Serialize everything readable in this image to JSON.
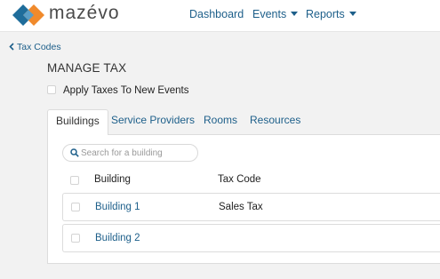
{
  "brand": {
    "name": "mazévo"
  },
  "nav": [
    {
      "label": "Dashboard",
      "has_caret": false
    },
    {
      "label": "Events",
      "has_caret": true
    },
    {
      "label": "Reports",
      "has_caret": true
    }
  ],
  "back_link": {
    "label": "Tax Codes"
  },
  "page_title": "MANAGE TAX",
  "apply_taxes": {
    "label": "Apply Taxes To New Events",
    "checked": false
  },
  "tabs": [
    {
      "label": "Buildings",
      "active": true
    },
    {
      "label": "Service Providers",
      "active": false
    },
    {
      "label": "Rooms",
      "active": false
    },
    {
      "label": "Resources",
      "active": false
    }
  ],
  "search": {
    "placeholder": "Search for a building",
    "value": ""
  },
  "table": {
    "headers": {
      "building": "Building",
      "tax_code": "Tax Code"
    },
    "rows": [
      {
        "building": "Building 1",
        "tax_code": "Sales Tax",
        "checked": false
      },
      {
        "building": "Building 2",
        "tax_code": "",
        "checked": false
      }
    ]
  },
  "colors": {
    "link": "#1d5f8a",
    "logo_blue": "#1f6d9b",
    "logo_orange": "#f08a2c",
    "background": "#f2f2f2"
  },
  "icons": [
    "mazevo-logo",
    "chevron-left-icon",
    "caret-down-icon",
    "search-icon",
    "checkbox"
  ]
}
